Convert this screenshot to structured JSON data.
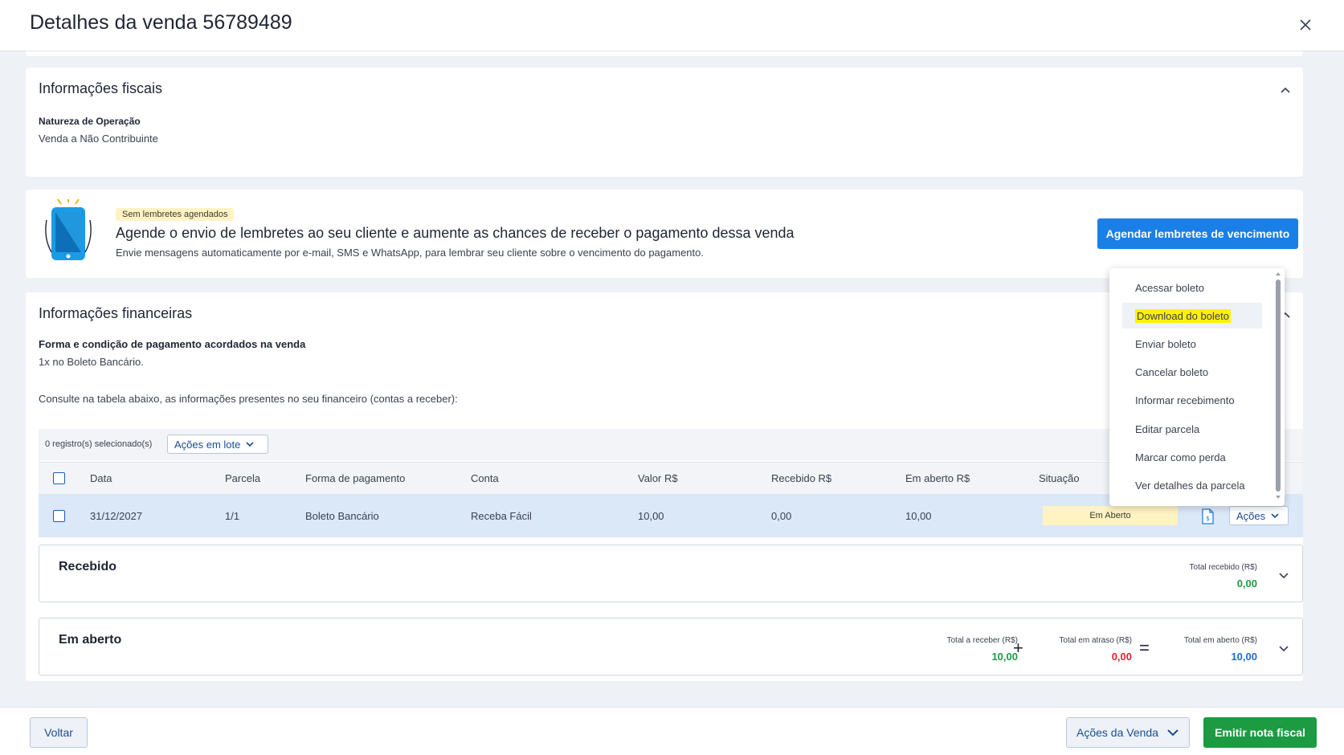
{
  "modal": {
    "title": "Detalhes da venda 56789489"
  },
  "fiscal": {
    "title": "Informações fiscais",
    "natureza_label": "Natureza de Operação",
    "natureza_value": "Venda a Não Contribuinte"
  },
  "reminder": {
    "badge": "Sem lembretes agendados",
    "title": "Agende o envio de lembretes ao seu cliente e aumente as chances de receber o pagamento dessa venda",
    "description": "Envie mensagens automaticamente por e-mail, SMS e WhatsApp, para lembrar seu cliente sobre o vencimento do pagamento.",
    "button": "Agendar lembretes de vencimento"
  },
  "financial": {
    "title": "Informações financeiras",
    "forma_label": "Forma e condição de pagamento acordados na venda",
    "forma_value": "1x no Boleto Bancário.",
    "consulte": "Consulte na tabela abaixo, as informações presentes no seu financeiro (contas a receber):",
    "selected_count": "0 registro(s) selecionado(s)",
    "batch_actions": "Ações em lote",
    "columns": [
      "Data",
      "Parcela",
      "Forma de pagamento",
      "Conta",
      "Valor R$",
      "Recebido R$",
      "Em aberto R$",
      "Situação"
    ],
    "row": {
      "data": "31/12/2027",
      "parcela": "1/1",
      "forma": "Boleto Bancário",
      "conta": "Receba Fácil",
      "valor": "10,00",
      "recebido": "0,00",
      "em_aberto": "10,00",
      "situacao": "Em Aberto",
      "acoes": "Ações"
    },
    "recebido": {
      "title": "Recebido",
      "total_label": "Total recebido (R$)",
      "total_value": "0,00"
    },
    "em_aberto": {
      "title": "Em aberto",
      "receber_label": "Total a receber (R$)",
      "receber_value": "10,00",
      "plus": "+",
      "atraso_label": "Total em atraso (R$)",
      "atraso_value": "0,00",
      "equals": "=",
      "aberto_label": "Total em aberto (R$)",
      "aberto_value": "10,00"
    }
  },
  "dropdown": {
    "items": [
      "Acessar boleto",
      "Download do boleto",
      "Enviar boleto",
      "Cancelar boleto",
      "Informar recebimento",
      "Editar parcela",
      "Marcar como perda",
      "Ver detalhes da parcela"
    ]
  },
  "footer": {
    "back": "Voltar",
    "sale_actions": "Ações da Venda",
    "emit": "Emitir nota fiscal"
  },
  "colors": {
    "primary_blue": "#1a7fe6",
    "green": "#1c9b43",
    "red": "#e5222b",
    "value_blue": "#1a6fd6",
    "highlight": "#fff200"
  }
}
